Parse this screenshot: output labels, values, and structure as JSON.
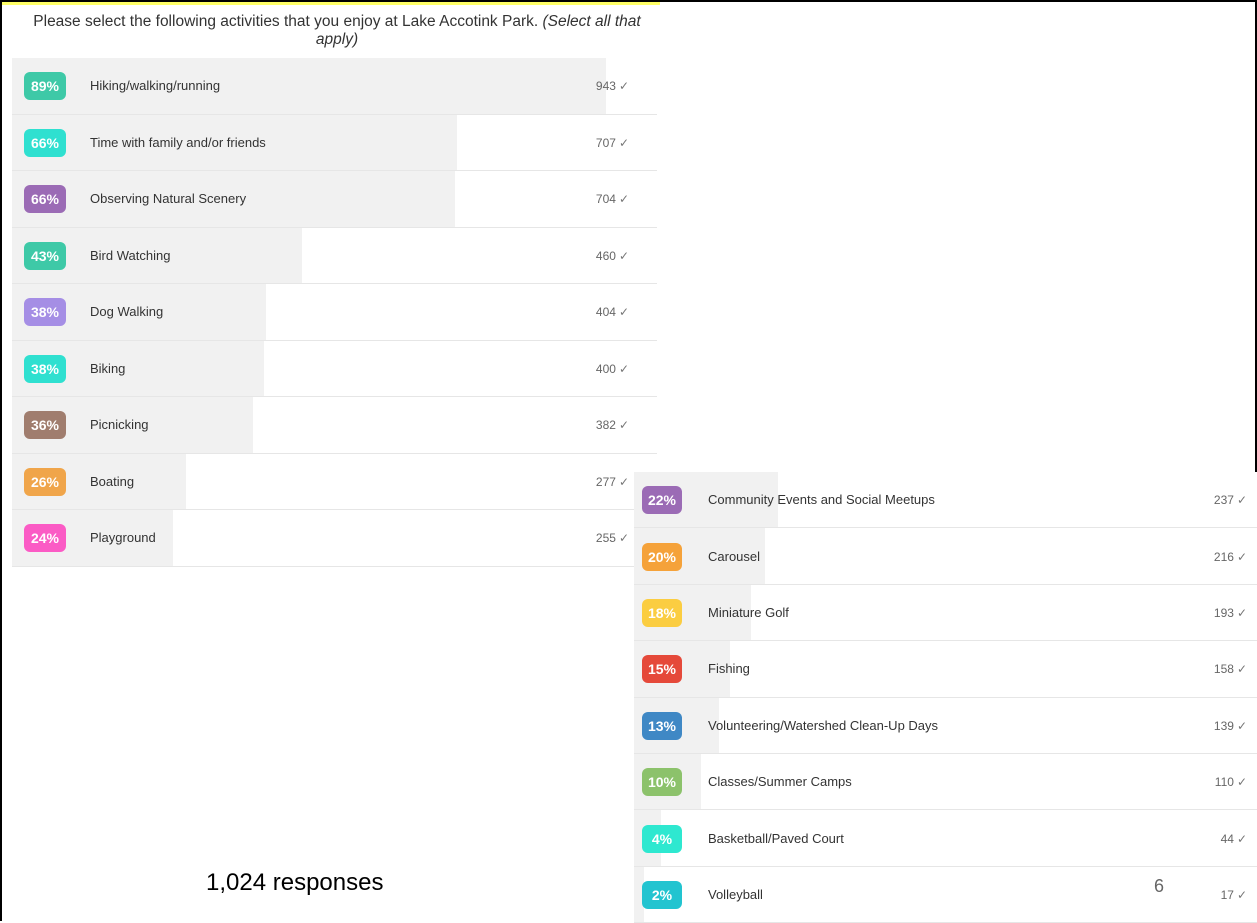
{
  "question": {
    "text": "Please select the following activities that you enjoy at Lake Accotink Park.",
    "hint": "(Select all that apply)"
  },
  "responses_text": "1,024 responses",
  "page_number": "6",
  "check_glyph": "✓",
  "chart_data": {
    "type": "bar",
    "title": "Please select the following activities that you enjoy at Lake Accotink Park. (Select all that apply)",
    "categories": [
      "Hiking/walking/running",
      "Time with family and/or friends",
      "Observing Natural Scenery",
      "Bird Watching",
      "Dog Walking",
      "Biking",
      "Picnicking",
      "Boating",
      "Playground",
      "Community Events and Social Meetups",
      "Carousel",
      "Miniature Golf",
      "Fishing",
      "Volunteering/Watershed Clean-Up Days",
      "Classes/Summer Camps",
      "Basketball/Paved Court",
      "Volleyball"
    ],
    "percent_labels": [
      "89%",
      "66%",
      "66%",
      "43%",
      "38%",
      "38%",
      "36%",
      "26%",
      "24%",
      "22%",
      "20%",
      "18%",
      "15%",
      "13%",
      "10%",
      "4%",
      "2%"
    ],
    "counts": [
      943,
      707,
      704,
      460,
      404,
      400,
      382,
      277,
      255,
      237,
      216,
      193,
      158,
      139,
      110,
      44,
      17
    ],
    "badge_colors": [
      "#3ec9a7",
      "#2fe0d0",
      "#9b6bb5",
      "#3ec9a7",
      "#a58ee5",
      "#2fe0d0",
      "#a07d6e",
      "#f0a54a",
      "#fb5bc5",
      "#9b6bb5",
      "#f5a23a",
      "#fbcd41",
      "#e5493a",
      "#3f88c5",
      "#8cc26b",
      "#2ee8d0",
      "#22c4d0"
    ],
    "total_responses": 1024
  }
}
